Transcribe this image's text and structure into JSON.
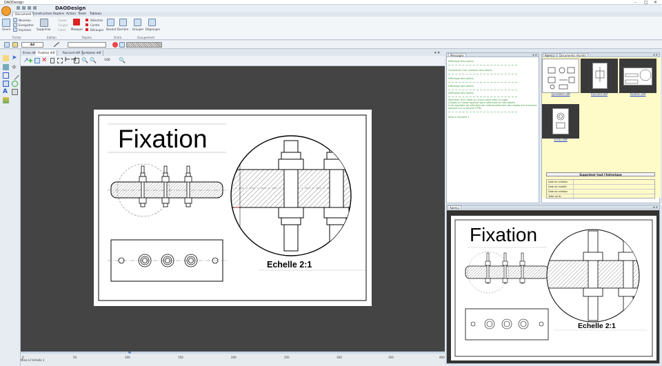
{
  "window": {
    "title": "DAODesign",
    "app_title": "DAODesign"
  },
  "ribbon_tabs": [
    "Document",
    "Construction",
    "Repère",
    "Action",
    "Texte",
    "Tableau"
  ],
  "ribbon": {
    "open": "Ouvrir",
    "nouveau": "Nouveau",
    "enregistrer": "Enregistrer",
    "imprimer": "Imprimer",
    "supprimer": "Supprimer",
    "copier": "Copier",
    "couper": "Couper",
    "coller": "Coller",
    "masquer": "Masquer",
    "selection": "Sélection",
    "centre": "Centre",
    "decoupe": "Découper",
    "devant": "Devant",
    "derriere": "Derrière",
    "grouper": "Grouper",
    "degrouper": "Dégrouper",
    "groups": [
      "Fichier",
      "Edition",
      "Repère",
      "Ordre",
      "Groupement"
    ]
  },
  "toolbar2": {
    "paper_size": "A4"
  },
  "doc_tabs": [
    "Ecrou ddf",
    "Fixation ddf",
    "Raccord ddf",
    "Symboles ddf"
  ],
  "dtoolbar": {
    "zoom": "100"
  },
  "drawing": {
    "title": "Fixation",
    "scale_label": "Echelle 2:1"
  },
  "ruler": {
    "ticks": [
      "0",
      "50",
      "100",
      "150",
      "200",
      "250",
      "300",
      "350",
      "400"
    ]
  },
  "status": "Mise à l'échelle 1",
  "messages_panel": {
    "tab": "Messages",
    "lines": [
      "Affichage des points.",
      "Ouverture d'un nouveau document.",
      "Affichage des points.",
      "Affichage des points.",
      "Affichage des points.",
      "Sélection d'un objet ou d'une zone dans la page.",
      "Cliquez et restez appuyé pour sélectionner des objets",
      "Il est possible de sélectionner individuellement des objets via la touche",
      "appuyé sur la touche CTRL.",
      "Mise à l'échelle 1"
    ]
  },
  "library_panel": {
    "tabs": [
      "Aperçu",
      "Documents récents"
    ],
    "items": [
      "Symboles ddf",
      "Raccord ddf",
      "fixation ddf",
      "Ecrou ddf"
    ],
    "history_button": "Supprimer tout l'historique",
    "history_rows": [
      "Date de création",
      "Date de modific",
      "Date de création",
      "Taille du fic"
    ]
  },
  "preview_panel": {
    "tab": "Aperçu"
  },
  "colors": {
    "canvas_bg": "#444444",
    "library_bg": "#fffbc8",
    "message_text": "#3a9a3a",
    "link_blue": "#1a3cc8"
  }
}
